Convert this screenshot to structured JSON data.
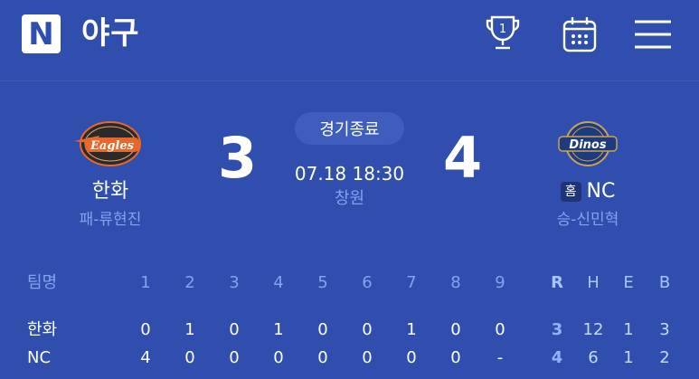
{
  "header": {
    "logo_letter": "N",
    "title": "야구",
    "icons": [
      "trophy-icon",
      "calendar-icon",
      "menu-icon"
    ]
  },
  "game": {
    "status": "경기종료",
    "datetime": "07.18 18:30",
    "stadium": "창원",
    "away": {
      "name": "한화",
      "score": "3",
      "pitcher": "패-류현진",
      "emblem_text": "Eagles",
      "emblem_color": "#e8672a"
    },
    "home": {
      "badge": "홈",
      "name": "NC",
      "score": "4",
      "pitcher": "승-신민혁",
      "emblem_text": "Dinos",
      "emblem_color": "#1e3b7d"
    }
  },
  "linescore": {
    "header": {
      "team": "팀명",
      "innings": [
        "1",
        "2",
        "3",
        "4",
        "5",
        "6",
        "7",
        "8",
        "9"
      ],
      "r": "R",
      "h": "H",
      "e": "E",
      "b": "B"
    },
    "rows": [
      {
        "team": "한화",
        "innings": [
          "0",
          "1",
          "0",
          "1",
          "0",
          "0",
          "1",
          "0",
          "0"
        ],
        "r": "3",
        "h": "12",
        "e": "1",
        "b": "3"
      },
      {
        "team": "NC",
        "innings": [
          "4",
          "0",
          "0",
          "0",
          "0",
          "0",
          "0",
          "0",
          "-"
        ],
        "r": "4",
        "h": "6",
        "e": "1",
        "b": "2"
      }
    ]
  },
  "colors": {
    "background": "#2f4eae",
    "accent_light": "#7fa5ee",
    "runs": "#8fb4ff"
  }
}
